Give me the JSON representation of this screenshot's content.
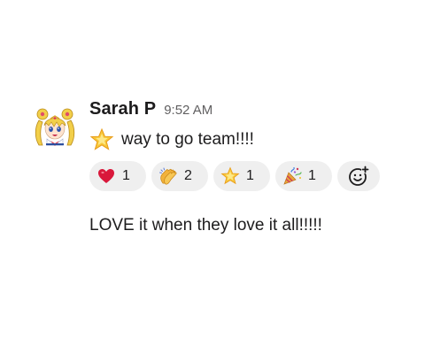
{
  "message": {
    "sender": "Sarah P",
    "timestamp": "9:52 AM",
    "text_icon": "glowing-star-icon",
    "text": "way to go team!!!!",
    "avatar_icon": "sailor-moon-avatar",
    "reactions": [
      {
        "icon": "red-heart-icon",
        "count": "1"
      },
      {
        "icon": "clapping-hands-icon",
        "count": "2"
      },
      {
        "icon": "glowing-star-icon",
        "count": "1"
      },
      {
        "icon": "party-popper-icon",
        "count": "1"
      }
    ],
    "add_reaction_icon": "add-reaction-icon"
  },
  "followup": {
    "text": "LOVE it when they love it all!!!!!"
  },
  "colors": {
    "text": "#1d1c1d",
    "timestamp": "#616061",
    "pill_bg": "#efefef",
    "star": "#f5c542",
    "heart": "#d9183b"
  }
}
